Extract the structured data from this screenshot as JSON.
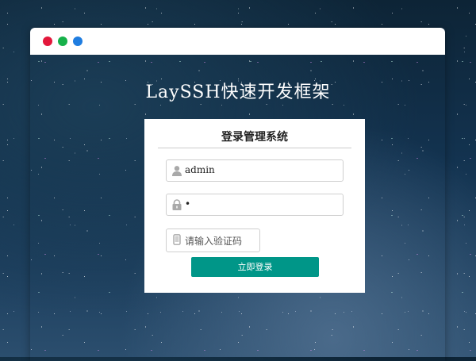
{
  "window": {
    "controls": [
      {
        "icon": "close-dot",
        "color": "#e3173b"
      },
      {
        "icon": "minimize-dot",
        "color": "#16b14a"
      },
      {
        "icon": "maximize-dot",
        "color": "#1f7de0"
      }
    ]
  },
  "app": {
    "title": "LaySSH快速开发框架"
  },
  "login": {
    "heading": "登录管理系统",
    "username": {
      "icon": "user-icon",
      "value": "admin"
    },
    "password": {
      "icon": "lock-icon",
      "value": "•"
    },
    "captcha": {
      "icon": "phone-icon",
      "placeholder": "请输入验证码",
      "value": ""
    },
    "submit_label": "立即登录",
    "accent": "#009688"
  }
}
